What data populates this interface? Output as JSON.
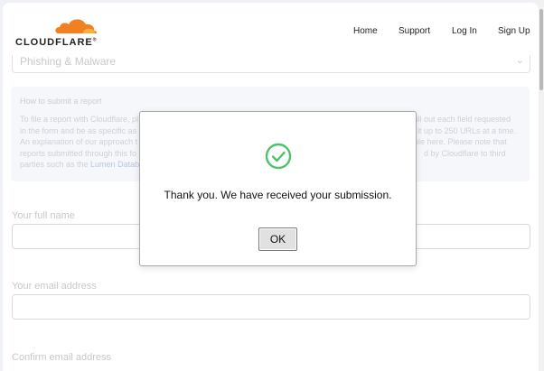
{
  "header": {
    "logo_text": "CLOUDFLARE",
    "logo_mark": "®",
    "nav": [
      "Home",
      "Support",
      "Log In",
      "Sign Up"
    ]
  },
  "form": {
    "report_type": "Phishing & Malware",
    "info_title": "How to submit a report",
    "info_line1": "To file a report with Cloudflare, pl",
    "info_line1b": "fill out each field requested",
    "info_line2": "in the form and be as specific as p",
    "info_line2b": "it up to 250 URLs at a time.",
    "info_line3": "An explanation of our approach t",
    "info_line3b": "able here. Please note that",
    "info_line4": "reports submitted through this fo",
    "info_line4b": "d by Cloudflare to third",
    "info_line5_pre": "parties such as the ",
    "info_line5_link": "Lumen Databa",
    "full_name_label": "Your full name",
    "email_label": "Your email address",
    "confirm_email_label": "Confirm email address"
  },
  "modal": {
    "icon": "check-circle-icon",
    "message": "Thank you. We have received your submission.",
    "ok_label": "OK"
  },
  "colors": {
    "brand_orange": "#f38020",
    "success_green": "#4cc26a"
  }
}
